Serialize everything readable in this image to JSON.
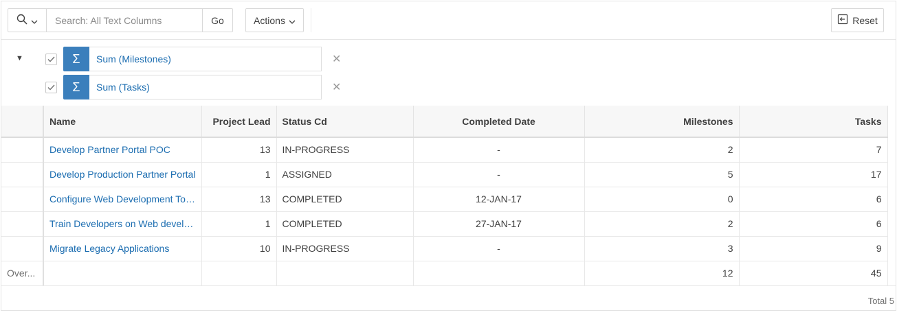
{
  "toolbar": {
    "search_placeholder": "Search: All Text Columns",
    "go_label": "Go",
    "actions_label": "Actions",
    "reset_label": "Reset"
  },
  "filters": [
    {
      "label": "Sum (Milestones)",
      "checked": true
    },
    {
      "label": "Sum (Tasks)",
      "checked": true
    }
  ],
  "table": {
    "headers": [
      "Name",
      "Project Lead",
      "Status Cd",
      "Completed Date",
      "Milestones",
      "Tasks"
    ],
    "rows": [
      {
        "name": "Develop Partner Portal POC",
        "lead": "13",
        "status": "IN-PROGRESS",
        "completed": "-",
        "milestones": "2",
        "tasks": "7"
      },
      {
        "name": "Develop Production Partner Portal",
        "lead": "1",
        "status": "ASSIGNED",
        "completed": "-",
        "milestones": "5",
        "tasks": "17"
      },
      {
        "name": "Configure Web Development Too...",
        "lead": "13",
        "status": "COMPLETED",
        "completed": "12-JAN-17",
        "milestones": "0",
        "tasks": "6"
      },
      {
        "name": "Train Developers on Web develop...",
        "lead": "1",
        "status": "COMPLETED",
        "completed": "27-JAN-17",
        "milestones": "2",
        "tasks": "6"
      },
      {
        "name": "Migrate Legacy Applications",
        "lead": "10",
        "status": "IN-PROGRESS",
        "completed": "-",
        "milestones": "3",
        "tasks": "9"
      }
    ],
    "aggregate": {
      "label": "Over...",
      "milestones": "12",
      "tasks": "45"
    }
  },
  "footer": {
    "total": "Total 5"
  },
  "colors": {
    "accent": "#3b7fbc",
    "link": "#1a6cb0"
  }
}
